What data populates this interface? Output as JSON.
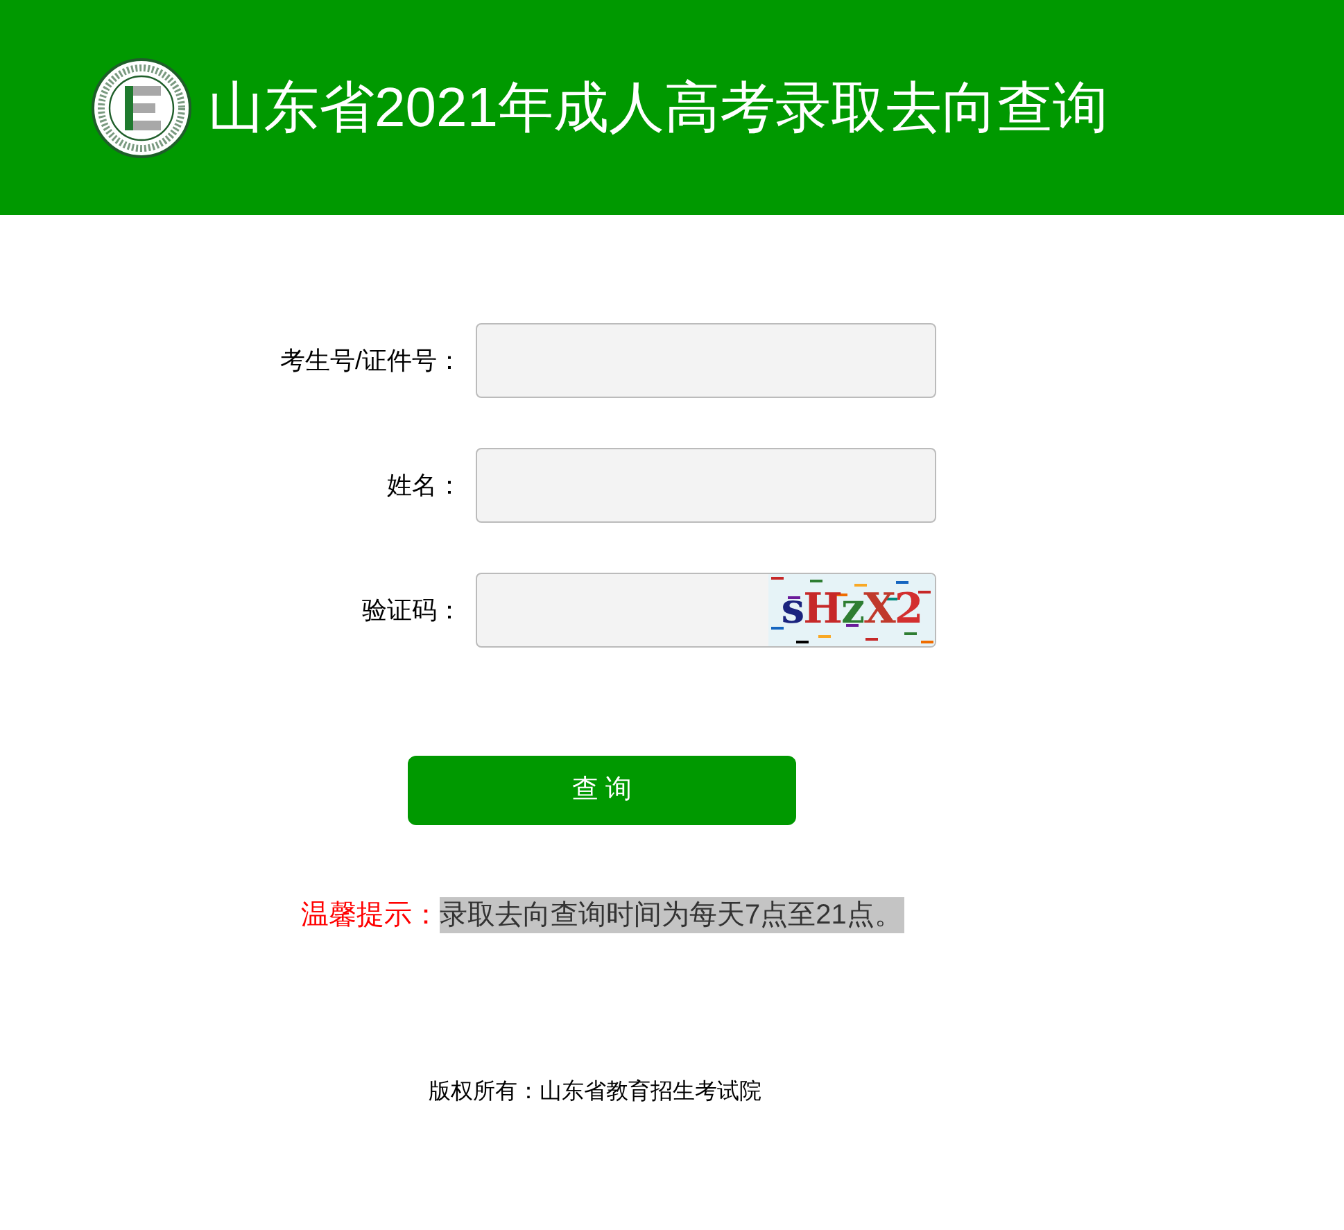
{
  "header": {
    "title": "山东省2021年成人高考录取去向查询"
  },
  "form": {
    "fields": [
      {
        "label": "考生号/证件号：",
        "kind": "text"
      },
      {
        "label": "姓名：",
        "kind": "text"
      },
      {
        "label": "验证码：",
        "kind": "captcha",
        "captcha": "sHzX2"
      }
    ],
    "submit": "查 询"
  },
  "notice": {
    "label": "温馨提示：",
    "text": "录取去向查询时间为每天7点至21点。"
  },
  "footer": "版权所有：山东省教育招生考试院"
}
